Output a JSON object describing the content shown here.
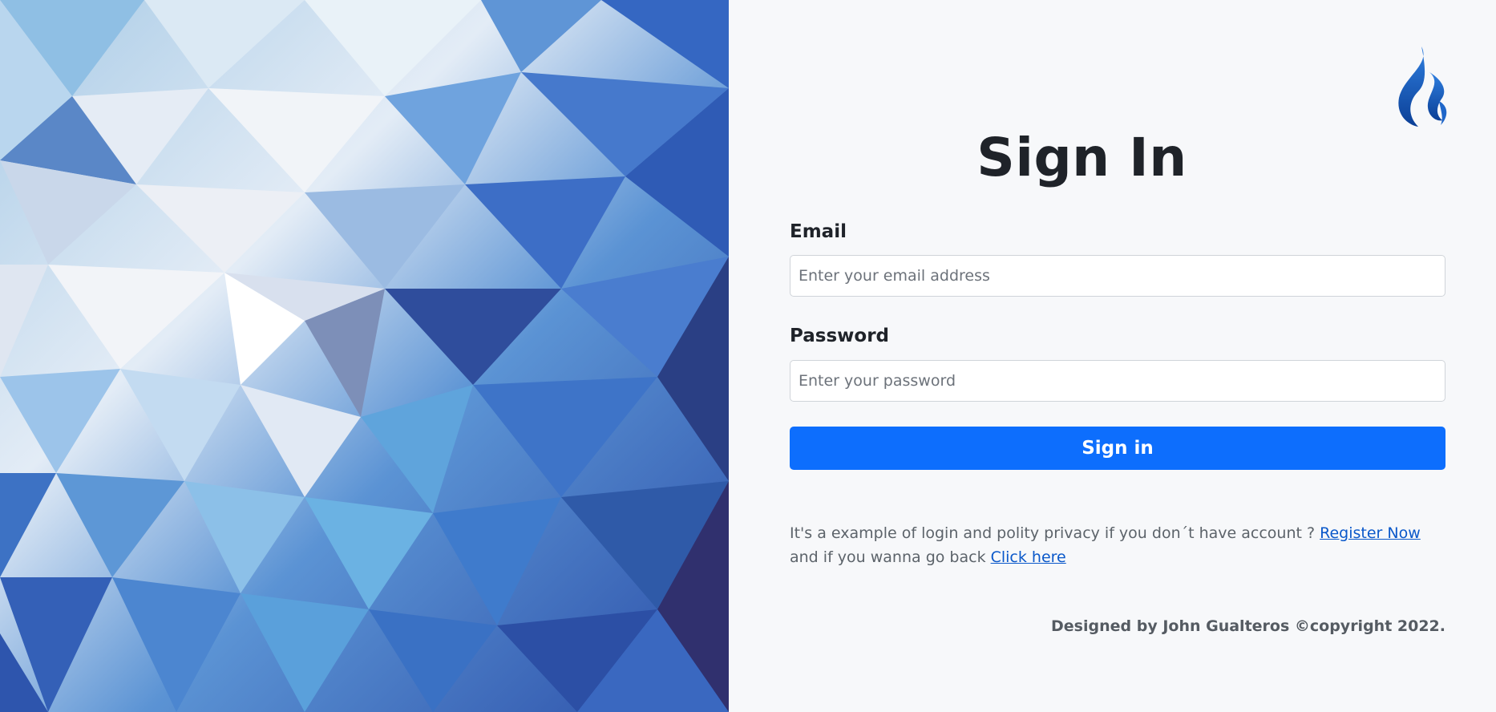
{
  "form": {
    "title": "Sign In",
    "email_label": "Email",
    "email_placeholder": "Enter your email address",
    "email_value": "",
    "password_label": "Password",
    "password_placeholder": "Enter your password",
    "password_value": "",
    "submit_label": "Sign in"
  },
  "note": {
    "text_before": "It's a example of login and polity privacy if you don´t have account ? ",
    "register_link": "Register Now",
    "text_middle": " and if you wanna go back ",
    "back_link": "Click here"
  },
  "footer": {
    "text": "Designed by John Gualteros ©copyright 2022."
  },
  "icons": {
    "logo": "flame-logo-icon",
    "artwork": "low-poly-blue-background"
  },
  "colors": {
    "primary": "#0d6efd",
    "link": "#0a58ca",
    "panel_background": "#f7f8fa",
    "title": "#1f2329"
  }
}
